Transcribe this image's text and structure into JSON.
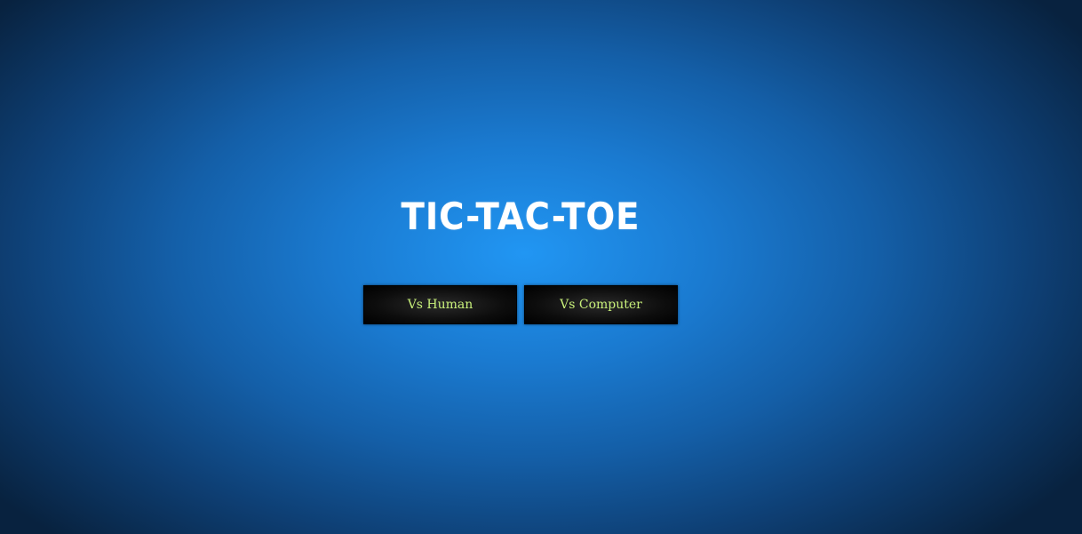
{
  "title": "TIC-TAC-TOE",
  "buttons": {
    "vs_human": "Vs Human",
    "vs_computer": "Vs Computer"
  },
  "colors": {
    "background_center": "#2196f3",
    "background_edge": "#08223f",
    "title": "#ffffff",
    "button_bg": "#000000",
    "button_text": "#c8f07a"
  }
}
